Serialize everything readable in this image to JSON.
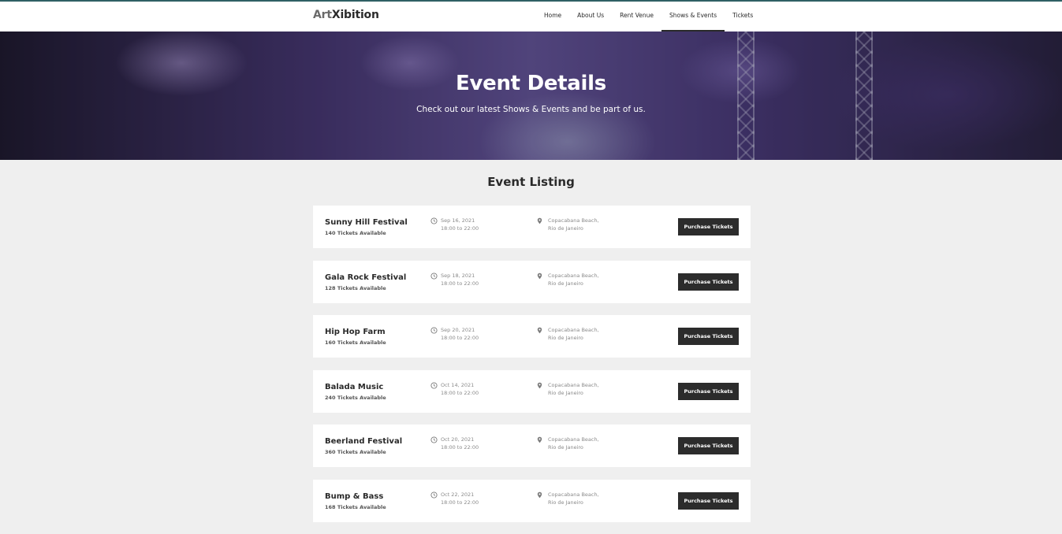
{
  "brand": {
    "part1": "Art",
    "part2": "Xibition"
  },
  "nav": [
    {
      "label": "Home",
      "active": false
    },
    {
      "label": "About Us",
      "active": false
    },
    {
      "label": "Rent Venue",
      "active": false
    },
    {
      "label": "Shows & Events",
      "active": true
    },
    {
      "label": "Tickets",
      "active": false
    }
  ],
  "hero": {
    "title": "Event Details",
    "subtitle": "Check out our latest Shows & Events and be part of us."
  },
  "listing": {
    "title": "Event Listing",
    "button_label": "Purchase Tickets",
    "events": [
      {
        "name": "Sunny Hill Festival",
        "tickets": "140 Tickets Available",
        "date": "Sep 16, 2021",
        "time": "18:00 to 22:00",
        "loc1": "Copacabana Beach,",
        "loc2": "Rio de Janeiro"
      },
      {
        "name": "Gala Rock Festival",
        "tickets": "128 Tickets Available",
        "date": "Sep 18, 2021",
        "time": "18:00 to 22:00",
        "loc1": "Copacabana Beach,",
        "loc2": "Rio de Janeiro"
      },
      {
        "name": "Hip Hop Farm",
        "tickets": "160 Tickets Available",
        "date": "Sep 20, 2021",
        "time": "18:00 to 22:00",
        "loc1": "Copacabana Beach,",
        "loc2": "Rio de Janeiro"
      },
      {
        "name": "Balada Music",
        "tickets": "240 Tickets Available",
        "date": "Oct 14, 2021",
        "time": "18:00 to 22:00",
        "loc1": "Copacabana Beach,",
        "loc2": "Rio de Janeiro"
      },
      {
        "name": "Beerland Festival",
        "tickets": "360 Tickets Available",
        "date": "Oct 20, 2021",
        "time": "18:00 to 22:00",
        "loc1": "Copacabana Beach,",
        "loc2": "Rio de Janeiro"
      },
      {
        "name": "Bump & Bass",
        "tickets": "168 Tickets Available",
        "date": "Oct 22, 2021",
        "time": "18:00 to 22:00",
        "loc1": "Copacabana Beach,",
        "loc2": "Rio de Janeiro"
      }
    ]
  },
  "icons": {
    "time": "clock-icon",
    "location": "map-pin-icon"
  },
  "colors": {
    "accent_line": "#2f6064",
    "button": "#2c2c2c",
    "background": "#efefef"
  }
}
